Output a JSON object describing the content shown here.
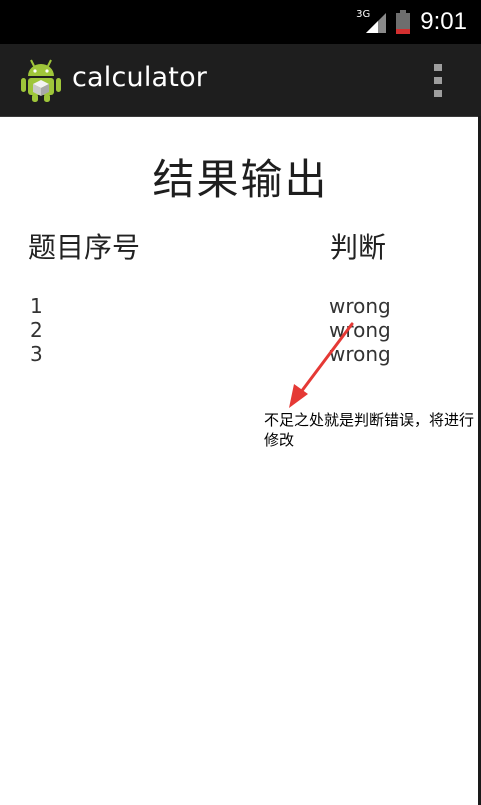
{
  "status_bar": {
    "network_type": "3G",
    "time": "9:01"
  },
  "action_bar": {
    "title": "calculator",
    "icon": "android-icon",
    "overflow_icon": "overflow-menu-icon"
  },
  "main": {
    "title": "结果输出",
    "headers": {
      "number": "题目序号",
      "judgement": "判断"
    },
    "rows": [
      {
        "number": "1",
        "result": "wrong"
      },
      {
        "number": "2",
        "result": "wrong"
      },
      {
        "number": "3",
        "result": "wrong"
      }
    ]
  },
  "annotation": {
    "text": "不足之处就是判断错误，将进行修改",
    "arrow_color": "#e53935"
  },
  "colors": {
    "status_bar": "#000000",
    "action_bar": "#1e1e1e",
    "android_green": "#9fc63a"
  }
}
